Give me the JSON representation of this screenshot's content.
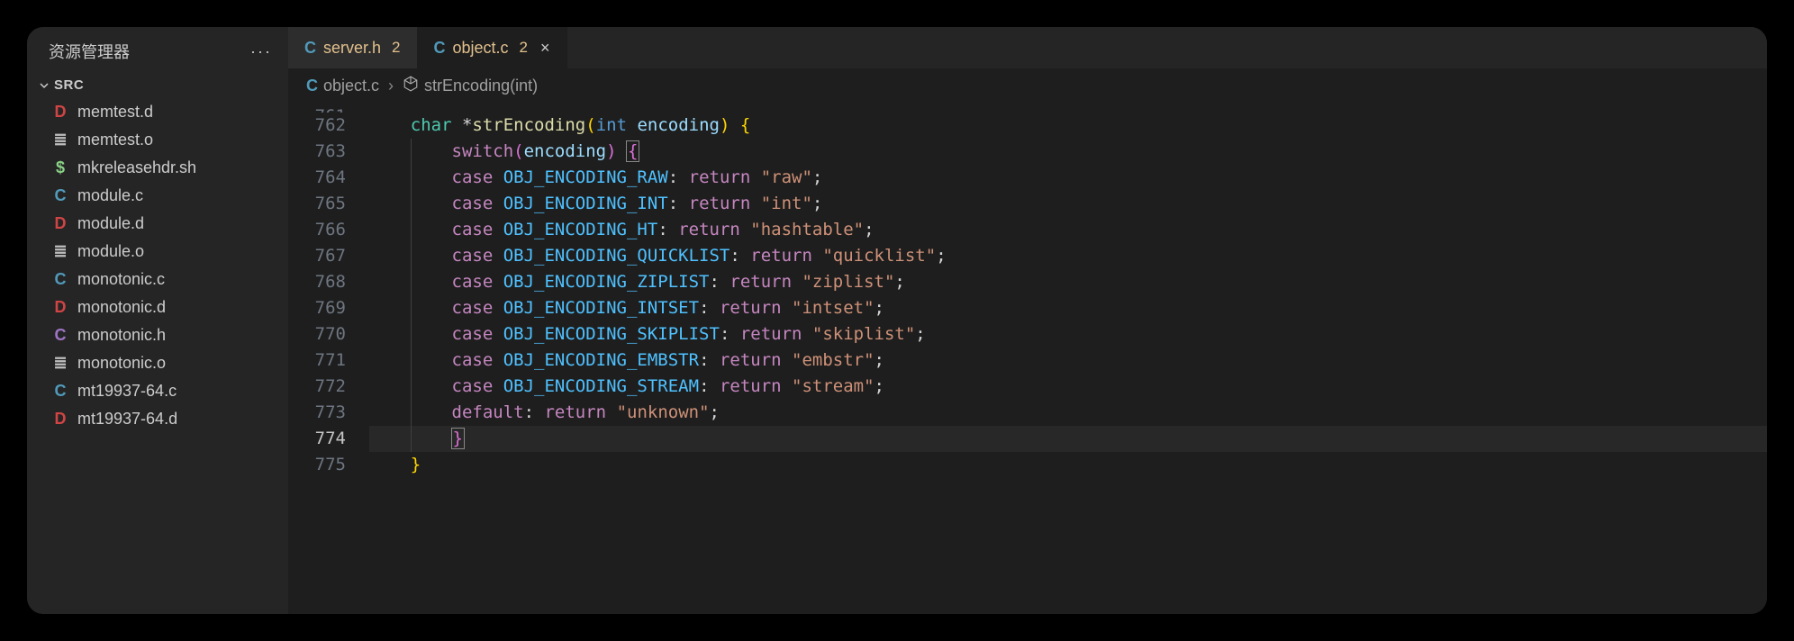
{
  "sidebar": {
    "title": "资源管理器",
    "folder": "SRC",
    "files": [
      {
        "icon": "D",
        "iconClass": "ic-d",
        "name": "memtest.d"
      },
      {
        "icon": "≣",
        "iconClass": "ic-o",
        "name": "memtest.o"
      },
      {
        "icon": "$",
        "iconClass": "ic-sh",
        "name": "mkreleasehdr.sh"
      },
      {
        "icon": "C",
        "iconClass": "ic-c",
        "name": "module.c"
      },
      {
        "icon": "D",
        "iconClass": "ic-d",
        "name": "module.d"
      },
      {
        "icon": "≣",
        "iconClass": "ic-o",
        "name": "module.o"
      },
      {
        "icon": "C",
        "iconClass": "ic-c",
        "name": "monotonic.c"
      },
      {
        "icon": "D",
        "iconClass": "ic-d",
        "name": "monotonic.d"
      },
      {
        "icon": "C",
        "iconClass": "ic-h",
        "name": "monotonic.h"
      },
      {
        "icon": "≣",
        "iconClass": "ic-o",
        "name": "monotonic.o"
      },
      {
        "icon": "C",
        "iconClass": "ic-c",
        "name": "mt19937-64.c"
      },
      {
        "icon": "D",
        "iconClass": "ic-d",
        "name": "mt19937-64.d"
      }
    ]
  },
  "tabs": [
    {
      "icon": "C",
      "iconClass": "ic-c",
      "name": "server.h",
      "badge": "2",
      "dirty": true,
      "active": false,
      "close": false
    },
    {
      "icon": "C",
      "iconClass": "ic-c",
      "name": "object.c",
      "badge": "2",
      "dirty": true,
      "active": true,
      "close": true
    }
  ],
  "breadcrumbs": {
    "fileIcon": "C",
    "file": "object.c",
    "symbol": "strEncoding(int)"
  },
  "editor": {
    "partial_top": "761",
    "active_line": 774,
    "lines": [
      {
        "n": 762,
        "tokens": [
          [
            "    ",
            ""
          ],
          [
            "char ",
            "tk-type"
          ],
          [
            "*",
            "tk-pun"
          ],
          [
            "strEncoding",
            "tk-fn"
          ],
          [
            "(",
            "tk-pun-y"
          ],
          [
            "int ",
            "tk-kw2"
          ],
          [
            "encoding",
            "tk-param"
          ],
          [
            ")",
            "tk-pun-y"
          ],
          [
            " ",
            ""
          ],
          [
            "{",
            "tk-pun-y"
          ]
        ]
      },
      {
        "n": 763,
        "tokens": [
          [
            "        ",
            ""
          ],
          [
            "switch",
            "tk-kw"
          ],
          [
            "(",
            "tk-pun-p"
          ],
          [
            "encoding",
            "tk-param"
          ],
          [
            ")",
            "tk-pun-p"
          ],
          [
            " ",
            ""
          ],
          [
            "{",
            "tk-pun-p tk-brace-match"
          ]
        ]
      },
      {
        "n": 764,
        "tokens": [
          [
            "        ",
            ""
          ],
          [
            "case ",
            "tk-kw"
          ],
          [
            "OBJ_ENCODING_RAW",
            "tk-const"
          ],
          [
            ": ",
            "tk-pun"
          ],
          [
            "return ",
            "tk-kw"
          ],
          [
            "\"raw\"",
            "tk-str"
          ],
          [
            ";",
            "tk-pun"
          ]
        ]
      },
      {
        "n": 765,
        "tokens": [
          [
            "        ",
            ""
          ],
          [
            "case ",
            "tk-kw"
          ],
          [
            "OBJ_ENCODING_INT",
            "tk-const"
          ],
          [
            ": ",
            "tk-pun"
          ],
          [
            "return ",
            "tk-kw"
          ],
          [
            "\"int\"",
            "tk-str"
          ],
          [
            ";",
            "tk-pun"
          ]
        ]
      },
      {
        "n": 766,
        "tokens": [
          [
            "        ",
            ""
          ],
          [
            "case ",
            "tk-kw"
          ],
          [
            "OBJ_ENCODING_HT",
            "tk-const"
          ],
          [
            ": ",
            "tk-pun"
          ],
          [
            "return ",
            "tk-kw"
          ],
          [
            "\"hashtable\"",
            "tk-str"
          ],
          [
            ";",
            "tk-pun"
          ]
        ]
      },
      {
        "n": 767,
        "tokens": [
          [
            "        ",
            ""
          ],
          [
            "case ",
            "tk-kw"
          ],
          [
            "OBJ_ENCODING_QUICKLIST",
            "tk-const"
          ],
          [
            ": ",
            "tk-pun"
          ],
          [
            "return ",
            "tk-kw"
          ],
          [
            "\"quicklist\"",
            "tk-str"
          ],
          [
            ";",
            "tk-pun"
          ]
        ]
      },
      {
        "n": 768,
        "tokens": [
          [
            "        ",
            ""
          ],
          [
            "case ",
            "tk-kw"
          ],
          [
            "OBJ_ENCODING_ZIPLIST",
            "tk-const"
          ],
          [
            ": ",
            "tk-pun"
          ],
          [
            "return ",
            "tk-kw"
          ],
          [
            "\"ziplist\"",
            "tk-str"
          ],
          [
            ";",
            "tk-pun"
          ]
        ]
      },
      {
        "n": 769,
        "tokens": [
          [
            "        ",
            ""
          ],
          [
            "case ",
            "tk-kw"
          ],
          [
            "OBJ_ENCODING_INTSET",
            "tk-const"
          ],
          [
            ": ",
            "tk-pun"
          ],
          [
            "return ",
            "tk-kw"
          ],
          [
            "\"intset\"",
            "tk-str"
          ],
          [
            ";",
            "tk-pun"
          ]
        ]
      },
      {
        "n": 770,
        "tokens": [
          [
            "        ",
            ""
          ],
          [
            "case ",
            "tk-kw"
          ],
          [
            "OBJ_ENCODING_SKIPLIST",
            "tk-const"
          ],
          [
            ": ",
            "tk-pun"
          ],
          [
            "return ",
            "tk-kw"
          ],
          [
            "\"skiplist\"",
            "tk-str"
          ],
          [
            ";",
            "tk-pun"
          ]
        ]
      },
      {
        "n": 771,
        "tokens": [
          [
            "        ",
            ""
          ],
          [
            "case ",
            "tk-kw"
          ],
          [
            "OBJ_ENCODING_EMBSTR",
            "tk-const"
          ],
          [
            ": ",
            "tk-pun"
          ],
          [
            "return ",
            "tk-kw"
          ],
          [
            "\"embstr\"",
            "tk-str"
          ],
          [
            ";",
            "tk-pun"
          ]
        ]
      },
      {
        "n": 772,
        "tokens": [
          [
            "        ",
            ""
          ],
          [
            "case ",
            "tk-kw"
          ],
          [
            "OBJ_ENCODING_STREAM",
            "tk-const"
          ],
          [
            ": ",
            "tk-pun"
          ],
          [
            "return ",
            "tk-kw"
          ],
          [
            "\"stream\"",
            "tk-str"
          ],
          [
            ";",
            "tk-pun"
          ]
        ]
      },
      {
        "n": 773,
        "tokens": [
          [
            "        ",
            ""
          ],
          [
            "default",
            "tk-kw"
          ],
          [
            ": ",
            "tk-pun"
          ],
          [
            "return ",
            "tk-kw"
          ],
          [
            "\"unknown\"",
            "tk-str"
          ],
          [
            ";",
            "tk-pun"
          ]
        ]
      },
      {
        "n": 774,
        "hl": true,
        "tokens": [
          [
            "        ",
            ""
          ],
          [
            "}",
            "tk-pun-p tk-brace-match"
          ]
        ]
      },
      {
        "n": 775,
        "tokens": [
          [
            "    ",
            ""
          ],
          [
            "}",
            "tk-pun-y"
          ]
        ]
      }
    ]
  }
}
